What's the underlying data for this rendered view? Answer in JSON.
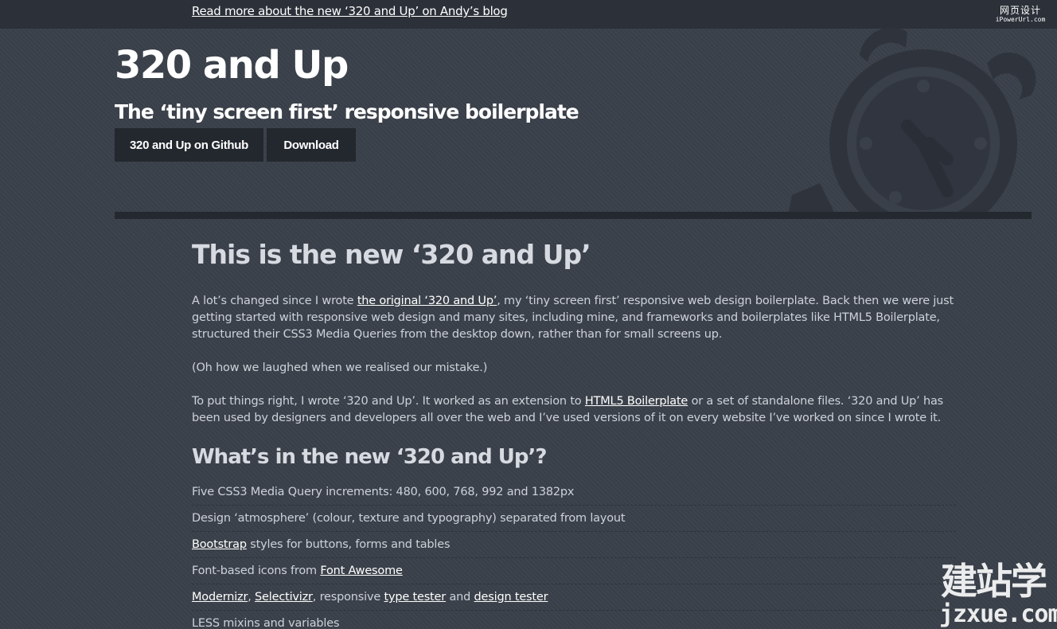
{
  "topbar": {
    "link_text": "Read more about the new ‘320 and Up’ on Andy’s blog"
  },
  "watermark_top": {
    "line1": "网页设计",
    "line2": "iPowerUrl.com"
  },
  "hero": {
    "title": "320 and Up",
    "subtitle": "The ‘tiny screen first’ responsive boilerplate",
    "buttons": {
      "github": "320 and Up on Github",
      "download": "Download"
    }
  },
  "main": {
    "heading": "This is the new ‘320 and Up’",
    "p1": {
      "before": "A lot’s changed since I wrote ",
      "link": "the original ‘320 and Up’",
      "after": ", my ‘tiny screen first’ responsive web design boilerplate. Back then we were just getting started with responsive web design and many sites, including mine, and frameworks and boilerplates like HTML5 Boilerplate, structured their CSS3 Media Queries from the desktop down, rather than for small screens up."
    },
    "p2": "(Oh how we laughed when we realised our mistake.)",
    "p3": {
      "before": "To put things right, I wrote ‘320 and Up’. It worked as an extension to ",
      "link": "HTML5 Boilerplate",
      "after": " or a set of standalone files. ‘320 and Up’ has been used by designers and developers all over the web and I’ve used versions of it on every website I’ve worked on since I wrote it."
    },
    "subheading": "What’s in the new ‘320 and Up’?",
    "features": {
      "f1": "Five CSS3 Media Query increments: 480, 600, 768, 992 and 1382px",
      "f2": "Design ‘atmosphere’ (colour, texture and typography) separated from layout",
      "f3": {
        "link": "Bootstrap",
        "after": " styles for buttons, forms and tables"
      },
      "f4": {
        "before": "Font-based icons from ",
        "link": "Font Awesome"
      },
      "f5": {
        "link1": "Modernizr",
        "sep1": ", ",
        "link2": "Selectivizr",
        "mid": ", responsive ",
        "link3": "type tester",
        "and": " and ",
        "link4": "design tester"
      },
      "f6": "LESS mixins and variables"
    }
  },
  "watermark_bottom": {
    "cn": "建站学",
    "en": "jzxue.com"
  },
  "colors": {
    "background": "#3a4049",
    "topbar": "#2c3139",
    "button": "#23272e",
    "divider": "#242930",
    "clock": "#2e333b"
  }
}
